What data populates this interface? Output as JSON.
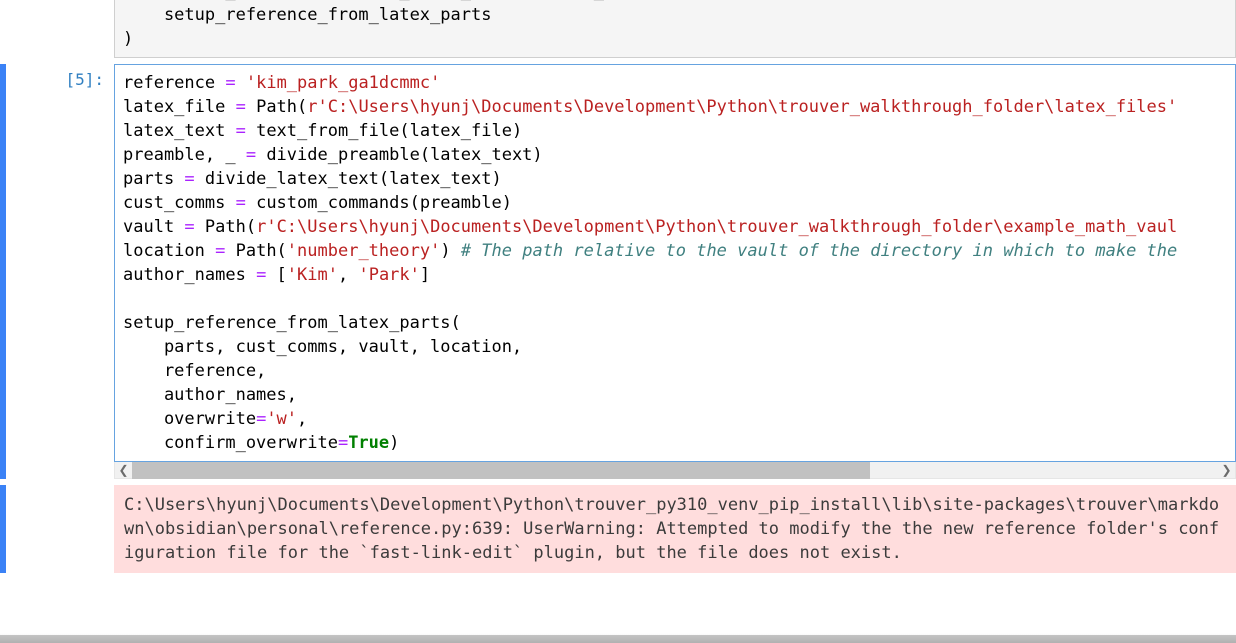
{
  "cells": {
    "prev": {
      "prompt": "",
      "code_lines": [
        {
          "segments": [
            {
              "cls": "tok-var",
              "t": "    divide_preamble, divide_latex_text, custom_commands,"
            }
          ]
        },
        {
          "segments": [
            {
              "cls": "tok-var",
              "t": "    setup_reference_from_latex_parts"
            }
          ]
        },
        {
          "segments": [
            {
              "cls": "tok-var",
              "t": ")"
            }
          ]
        }
      ]
    },
    "cell5": {
      "prompt": "[5]:",
      "code_lines": [
        {
          "segments": [
            {
              "cls": "tok-var",
              "t": "reference "
            },
            {
              "cls": "tok-op",
              "t": "="
            },
            {
              "cls": "tok-var",
              "t": " "
            },
            {
              "cls": "tok-str",
              "t": "'kim_park_ga1dcmmc'"
            }
          ]
        },
        {
          "segments": [
            {
              "cls": "tok-var",
              "t": "latex_file "
            },
            {
              "cls": "tok-op",
              "t": "="
            },
            {
              "cls": "tok-var",
              "t": " Path("
            },
            {
              "cls": "tok-str",
              "t": "r'C:\\Users\\hyunj\\Documents\\Development\\Python\\trouver_walkthrough_folder\\latex_files'"
            }
          ]
        },
        {
          "segments": [
            {
              "cls": "tok-var",
              "t": "latex_text "
            },
            {
              "cls": "tok-op",
              "t": "="
            },
            {
              "cls": "tok-var",
              "t": " text_from_file(latex_file)"
            }
          ]
        },
        {
          "segments": [
            {
              "cls": "tok-var",
              "t": "preamble, _ "
            },
            {
              "cls": "tok-op",
              "t": "="
            },
            {
              "cls": "tok-var",
              "t": " divide_preamble(latex_text)"
            }
          ]
        },
        {
          "segments": [
            {
              "cls": "tok-var",
              "t": "parts "
            },
            {
              "cls": "tok-op",
              "t": "="
            },
            {
              "cls": "tok-var",
              "t": " divide_latex_text(latex_text)"
            }
          ]
        },
        {
          "segments": [
            {
              "cls": "tok-var",
              "t": "cust_comms "
            },
            {
              "cls": "tok-op",
              "t": "="
            },
            {
              "cls": "tok-var",
              "t": " custom_commands(preamble)"
            }
          ]
        },
        {
          "segments": [
            {
              "cls": "tok-var",
              "t": "vault "
            },
            {
              "cls": "tok-op",
              "t": "="
            },
            {
              "cls": "tok-var",
              "t": " Path("
            },
            {
              "cls": "tok-str",
              "t": "r'C:\\Users\\hyunj\\Documents\\Development\\Python\\trouver_walkthrough_folder\\example_math_vaul"
            }
          ]
        },
        {
          "segments": [
            {
              "cls": "tok-var",
              "t": "location "
            },
            {
              "cls": "tok-op",
              "t": "="
            },
            {
              "cls": "tok-var",
              "t": " Path("
            },
            {
              "cls": "tok-str",
              "t": "'number_theory'"
            },
            {
              "cls": "tok-var",
              "t": ") "
            },
            {
              "cls": "tok-comment",
              "t": "# The path relative to the vault of the directory in which to make the"
            }
          ]
        },
        {
          "segments": [
            {
              "cls": "tok-var",
              "t": "author_names "
            },
            {
              "cls": "tok-op",
              "t": "="
            },
            {
              "cls": "tok-var",
              "t": " ["
            },
            {
              "cls": "tok-str",
              "t": "'Kim'"
            },
            {
              "cls": "tok-var",
              "t": ", "
            },
            {
              "cls": "tok-str",
              "t": "'Park'"
            },
            {
              "cls": "tok-var",
              "t": "]"
            }
          ]
        },
        {
          "segments": [
            {
              "cls": "tok-var",
              "t": ""
            }
          ]
        },
        {
          "segments": [
            {
              "cls": "tok-var",
              "t": "setup_reference_from_latex_parts("
            }
          ]
        },
        {
          "segments": [
            {
              "cls": "tok-var",
              "t": "    parts, cust_comms, vault, location,"
            }
          ]
        },
        {
          "segments": [
            {
              "cls": "tok-var",
              "t": "    reference,"
            }
          ]
        },
        {
          "segments": [
            {
              "cls": "tok-var",
              "t": "    author_names,"
            }
          ]
        },
        {
          "segments": [
            {
              "cls": "tok-var",
              "t": "    overwrite"
            },
            {
              "cls": "tok-op",
              "t": "="
            },
            {
              "cls": "tok-str",
              "t": "'w'"
            },
            {
              "cls": "tok-var",
              "t": ","
            }
          ]
        },
        {
          "segments": [
            {
              "cls": "tok-var",
              "t": "    confirm_overwrite"
            },
            {
              "cls": "tok-op",
              "t": "="
            },
            {
              "cls": "tok-bool",
              "t": "True"
            },
            {
              "cls": "tok-var",
              "t": ")"
            }
          ]
        }
      ],
      "stderr": "C:\\Users\\hyunj\\Documents\\Development\\Python\\trouver_py310_venv_pip_install\\lib\\site-packages\\trouver\\markdown\\obsidian\\personal\\reference.py:639: UserWarning: Attempted to modify the the new reference folder's configuration file for the `fast-link-edit` plugin, but the file does not exist."
    }
  },
  "scroll": {
    "left_arrow": "❮",
    "right_arrow": "❯"
  }
}
